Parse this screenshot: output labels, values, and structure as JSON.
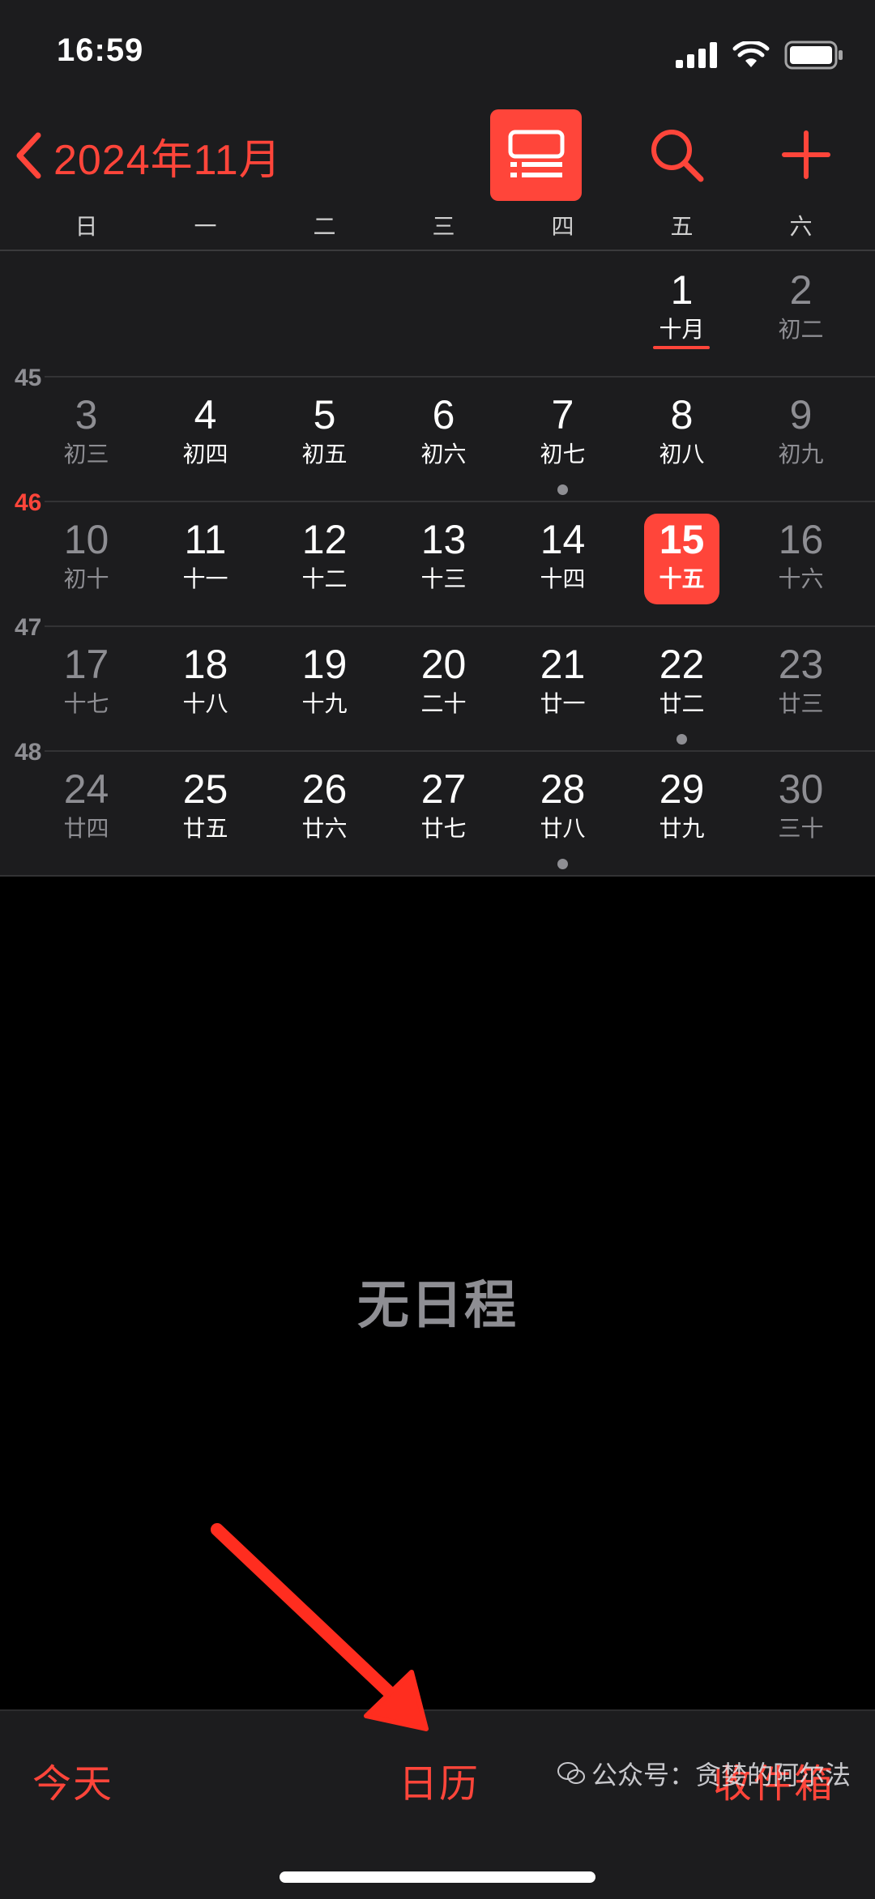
{
  "status": {
    "time": "16:59"
  },
  "nav": {
    "back_label": "2024年11月"
  },
  "weekdays": [
    "日",
    "一",
    "二",
    "三",
    "四",
    "五",
    "六"
  ],
  "weeks": [
    {
      "week_number": "",
      "current": false,
      "days": [
        null,
        null,
        null,
        null,
        null,
        {
          "num": "1",
          "lunar": "十月",
          "underline": true
        },
        {
          "num": "2",
          "lunar": "初二"
        }
      ]
    },
    {
      "week_number": "45",
      "current": false,
      "days": [
        {
          "num": "3",
          "lunar": "初三"
        },
        {
          "num": "4",
          "lunar": "初四"
        },
        {
          "num": "5",
          "lunar": "初五"
        },
        {
          "num": "6",
          "lunar": "初六"
        },
        {
          "num": "7",
          "lunar": "初七",
          "dot": true
        },
        {
          "num": "8",
          "lunar": "初八"
        },
        {
          "num": "9",
          "lunar": "初九"
        }
      ]
    },
    {
      "week_number": "46",
      "current": true,
      "days": [
        {
          "num": "10",
          "lunar": "初十"
        },
        {
          "num": "11",
          "lunar": "十一"
        },
        {
          "num": "12",
          "lunar": "十二"
        },
        {
          "num": "13",
          "lunar": "十三"
        },
        {
          "num": "14",
          "lunar": "十四"
        },
        {
          "num": "15",
          "lunar": "十五",
          "today": true
        },
        {
          "num": "16",
          "lunar": "十六"
        }
      ]
    },
    {
      "week_number": "47",
      "current": false,
      "days": [
        {
          "num": "17",
          "lunar": "十七"
        },
        {
          "num": "18",
          "lunar": "十八"
        },
        {
          "num": "19",
          "lunar": "十九"
        },
        {
          "num": "20",
          "lunar": "二十"
        },
        {
          "num": "21",
          "lunar": "廿一"
        },
        {
          "num": "22",
          "lunar": "廿二",
          "dot": true
        },
        {
          "num": "23",
          "lunar": "廿三"
        }
      ]
    },
    {
      "week_number": "48",
      "current": false,
      "days": [
        {
          "num": "24",
          "lunar": "廿四"
        },
        {
          "num": "25",
          "lunar": "廿五"
        },
        {
          "num": "26",
          "lunar": "廿六"
        },
        {
          "num": "27",
          "lunar": "廿七"
        },
        {
          "num": "28",
          "lunar": "廿八",
          "dot": true
        },
        {
          "num": "29",
          "lunar": "廿九"
        },
        {
          "num": "30",
          "lunar": "三十"
        }
      ]
    }
  ],
  "empty_state": "无日程",
  "tabs": {
    "today": "今天",
    "calendars": "日历",
    "inbox": "收件箱"
  },
  "watermark": "公众号：贪婪的阿尔法",
  "colors": {
    "accent": "#ff453a",
    "background": "#000000",
    "panel": "#1c1c1e",
    "secondary_text": "#8e8e93"
  },
  "icons": [
    "signal-icon",
    "wifi-icon",
    "battery-icon",
    "chevron-left-icon",
    "list-view-icon",
    "search-icon",
    "plus-icon",
    "annotation-arrow"
  ]
}
